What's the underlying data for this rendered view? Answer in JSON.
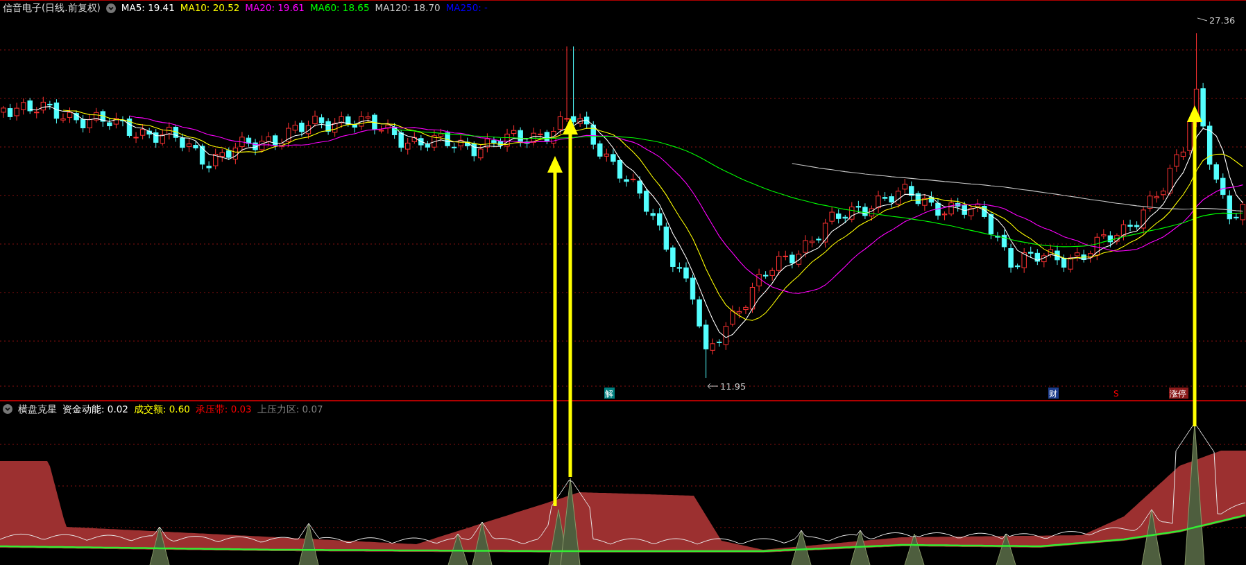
{
  "main_chart": {
    "title": "信音电子(日线.前复权)",
    "ma_lines": [
      {
        "text": "MA5: 19.41",
        "color": "#ffffff"
      },
      {
        "text": "MA10: 20.52",
        "color": "#ffff00"
      },
      {
        "text": "MA20: 19.61",
        "color": "#ff00ff"
      },
      {
        "text": "MA60: 18.65",
        "color": "#00ff00"
      },
      {
        "text": "MA120: 18.70",
        "color": "#c8c8c8"
      },
      {
        "text": "MA250: -",
        "color": "#0000ff"
      }
    ],
    "high_label": "27.36",
    "low_label": "11.95",
    "event_tags": [
      {
        "text": "解",
        "kind": "badge",
        "color": "#008080"
      },
      {
        "text": "财",
        "kind": "badge",
        "color": "#1c3c8c"
      },
      {
        "text": "S",
        "kind": "mark",
        "color": "#ff0000"
      },
      {
        "text": "涨停",
        "kind": "badge",
        "color": "#8b1a1a"
      }
    ]
  },
  "indicator": {
    "title": "横盘克星",
    "values": [
      {
        "text": "资金动能: 0.02",
        "color": "#ffffff"
      },
      {
        "text": "成交额: 0.60",
        "color": "#ffff00"
      },
      {
        "text": "承压带: 0.03",
        "color": "#ff0000"
      },
      {
        "text": "上压力区: 0.07",
        "color": "#808080"
      }
    ]
  }
}
